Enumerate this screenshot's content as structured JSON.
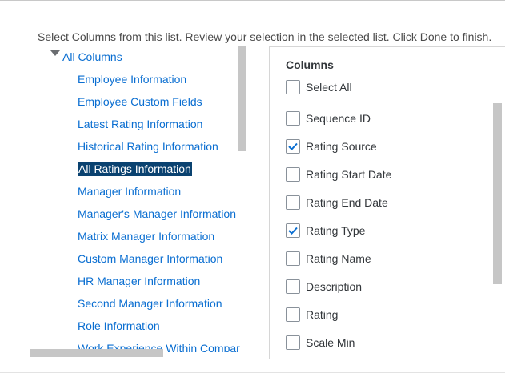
{
  "instruction": "Select Columns from this list. Review your selection in the selected list. Click Done to finish.",
  "tree": {
    "root_label": "All Columns",
    "items": [
      {
        "label": "Employee Information",
        "selected": false
      },
      {
        "label": "Employee Custom Fields",
        "selected": false
      },
      {
        "label": "Latest Rating Information",
        "selected": false
      },
      {
        "label": "Historical Rating Information",
        "selected": false
      },
      {
        "label": "All Ratings Information",
        "selected": true
      },
      {
        "label": "Manager Information",
        "selected": false
      },
      {
        "label": "Manager's Manager Information",
        "selected": false
      },
      {
        "label": "Matrix Manager Information",
        "selected": false
      },
      {
        "label": "Custom Manager Information",
        "selected": false
      },
      {
        "label": "HR Manager Information",
        "selected": false
      },
      {
        "label": "Second Manager Information",
        "selected": false
      },
      {
        "label": "Role Information",
        "selected": false
      },
      {
        "label": "Work Experience Within Compar",
        "selected": false
      }
    ]
  },
  "columns": {
    "header": "Columns",
    "select_all": {
      "label": "Select All",
      "checked": false
    },
    "items": [
      {
        "label": "Sequence ID",
        "checked": false
      },
      {
        "label": "Rating Source",
        "checked": true
      },
      {
        "label": "Rating Start Date",
        "checked": false
      },
      {
        "label": "Rating End Date",
        "checked": false
      },
      {
        "label": "Rating Type",
        "checked": true
      },
      {
        "label": "Rating Name",
        "checked": false
      },
      {
        "label": "Description",
        "checked": false
      },
      {
        "label": "Rating",
        "checked": false
      },
      {
        "label": "Scale Min",
        "checked": false
      }
    ]
  },
  "colors": {
    "link": "#0a6ed1",
    "selected_bg": "#0a4270",
    "check": "#0a6ed1"
  }
}
